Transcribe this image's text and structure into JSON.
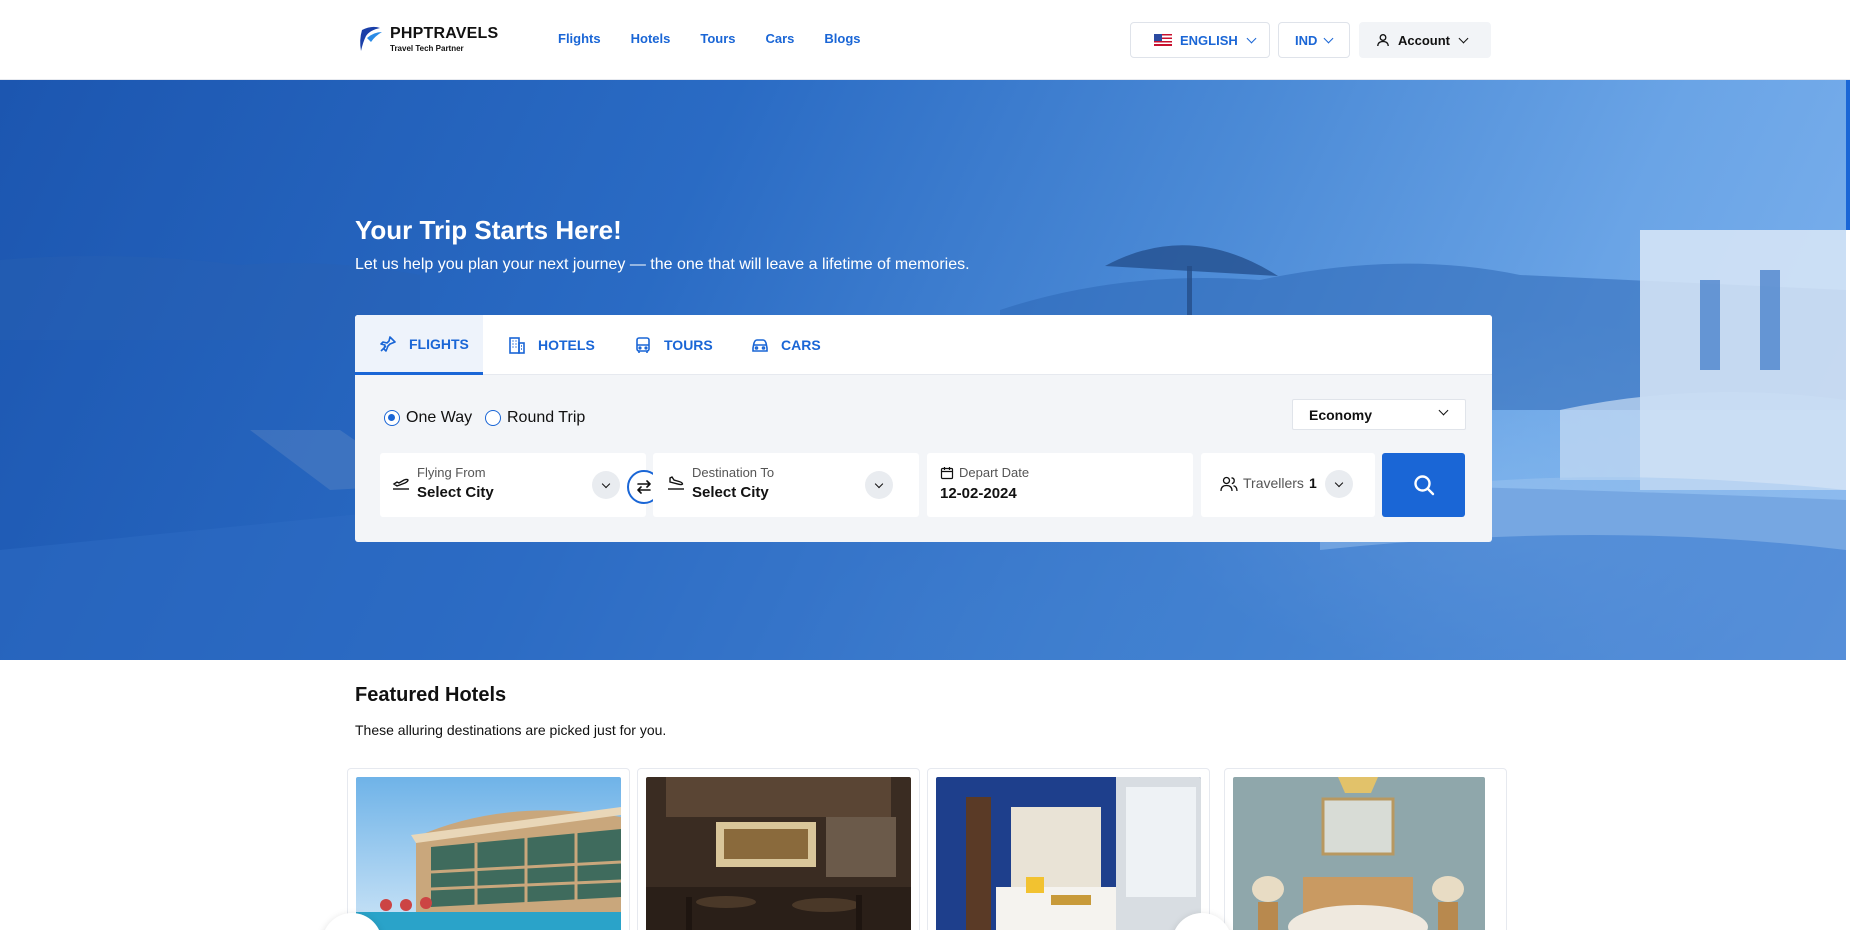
{
  "brand": {
    "name": "PHPTRAVELS",
    "tagline": "Travel Tech Partner"
  },
  "nav": {
    "items": [
      "Flights",
      "Hotels",
      "Tours",
      "Cars",
      "Blogs"
    ]
  },
  "header": {
    "language": "ENGLISH",
    "currency": "IND",
    "account": "Account"
  },
  "hero": {
    "title": "Your Trip Starts Here!",
    "subtitle": "Let us help you plan your next journey — the one that will leave a lifetime of memories."
  },
  "search": {
    "tabs": [
      "FLIGHTS",
      "HOTELS",
      "TOURS",
      "CARS"
    ],
    "active_tab": "FLIGHTS",
    "trip_types": [
      "One Way",
      "Round Trip"
    ],
    "selected_trip": "One Way",
    "cabin_class": "Economy",
    "from": {
      "label": "Flying From",
      "value": "Select City"
    },
    "to": {
      "label": "Destination To",
      "value": "Select City"
    },
    "depart": {
      "label": "Depart Date",
      "value": "12-02-2024"
    },
    "travellers": {
      "label": "Travellers",
      "value": "1"
    }
  },
  "featured": {
    "title": "Featured Hotels",
    "subtitle": "These alluring destinations are picked just for you."
  },
  "colors": {
    "accent": "#1a66d6",
    "text": "#111111",
    "surface": "#f3f5f8"
  },
  "icons": [
    "logo-icon",
    "flag-us-icon",
    "user-icon",
    "chevron-down-icon",
    "plane-icon",
    "hotel-icon",
    "bus-icon",
    "car-icon",
    "takeoff-icon",
    "landing-icon",
    "swap-icon",
    "calendar-icon",
    "users-icon",
    "search-icon"
  ]
}
